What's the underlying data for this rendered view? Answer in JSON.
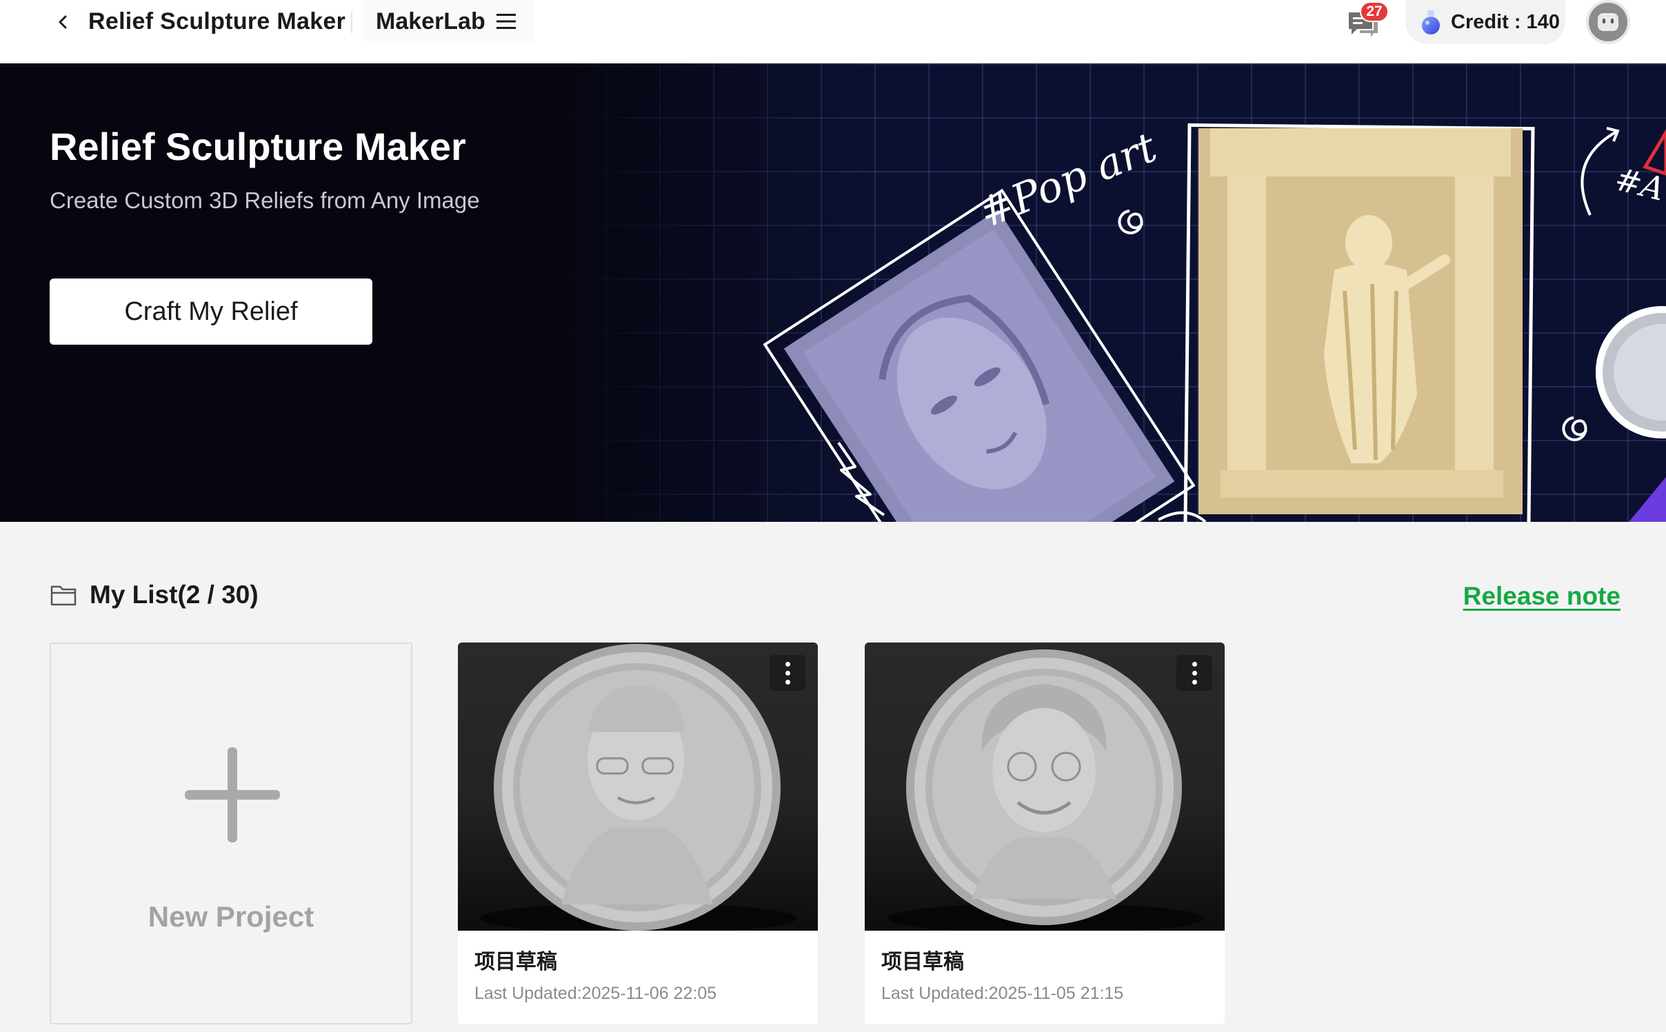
{
  "topbar": {
    "app_title": "Relief Sculpture Maker",
    "makerlab_label": "MakerLab",
    "notification_count": "27",
    "credit_label": "Credit : 140"
  },
  "hero": {
    "title": "Relief Sculpture Maker",
    "subtitle": "Create Custom 3D Reliefs from Any Image",
    "cta_label": "Craft My Relief",
    "tag_popart": "#Pop art",
    "tag_partial": "#A"
  },
  "list": {
    "title": "My List(2 / 30)",
    "release_note_label": "Release note",
    "new_project_label": "New Project",
    "projects": [
      {
        "name": "项目草稿",
        "updated": "Last Updated:2025-11-06 22:05"
      },
      {
        "name": "项目草稿",
        "updated": "Last Updated:2025-11-05 21:15"
      }
    ]
  },
  "colors": {
    "accent_green": "#15a944",
    "badge_red": "#e5393a",
    "hero_bg": "#05060f"
  }
}
